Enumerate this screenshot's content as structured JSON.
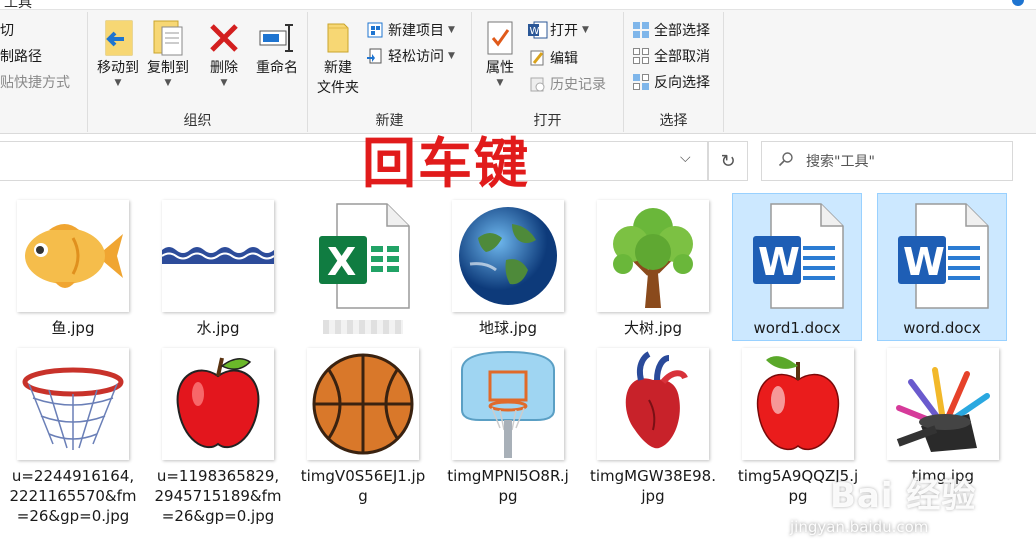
{
  "ribbon": {
    "clipboard": {
      "cut": "剪切",
      "copy_path": "复制路径",
      "paste_shortcut": "粘贴快捷方式"
    },
    "organize": {
      "move_to": "移动到",
      "copy_to": "复制到",
      "delete": "删除",
      "rename": "重命名",
      "label": "组织"
    },
    "new": {
      "new_folder_line1": "新建",
      "new_folder_line2": "文件夹",
      "new_item": "新建项目",
      "easy_access": "轻松访问",
      "label": "新建"
    },
    "open": {
      "properties": "属性",
      "open": "打开",
      "edit": "编辑",
      "history": "历史记录",
      "label": "打开"
    },
    "select": {
      "select_all": "全部选择",
      "select_none": "全部取消",
      "invert": "反向选择",
      "label": "选择"
    }
  },
  "address": {
    "search_placeholder": "搜索\"工具\""
  },
  "overlay_caption": "回车键",
  "files": [
    {
      "name": "鱼.jpg",
      "kind": "fish"
    },
    {
      "name": "水.jpg",
      "kind": "water"
    },
    {
      "name": "",
      "kind": "excel"
    },
    {
      "name": "地球.jpg",
      "kind": "earth"
    },
    {
      "name": "大树.jpg",
      "kind": "tree"
    },
    {
      "name": "word1.docx",
      "kind": "word",
      "selected": true
    },
    {
      "name": "word.docx",
      "kind": "word",
      "selected": true
    },
    {
      "name": "u=2244916164,2221165570&fm=26&gp=0.jpg",
      "kind": "hoop"
    },
    {
      "name": "u=1198365829,2945715189&fm=26&gp=0.jpg",
      "kind": "apple"
    },
    {
      "name": "timgV0S56EJ1.jpg",
      "kind": "basketball"
    },
    {
      "name": "timgMPNI5O8R.jpg",
      "kind": "backboard"
    },
    {
      "name": "timgMGW38E98.jpg",
      "kind": "heart"
    },
    {
      "name": "timg5A9QQZJ5.jpg",
      "kind": "apple2"
    },
    {
      "name": "timg.jpg",
      "kind": "magic"
    }
  ],
  "watermark": {
    "brand": "Bai 经验",
    "url": "jingyan.baidu.com"
  },
  "colors": {
    "accent": "#1e74d0",
    "selection": "#cce8ff",
    "overlay_text": "#e11b1b"
  }
}
